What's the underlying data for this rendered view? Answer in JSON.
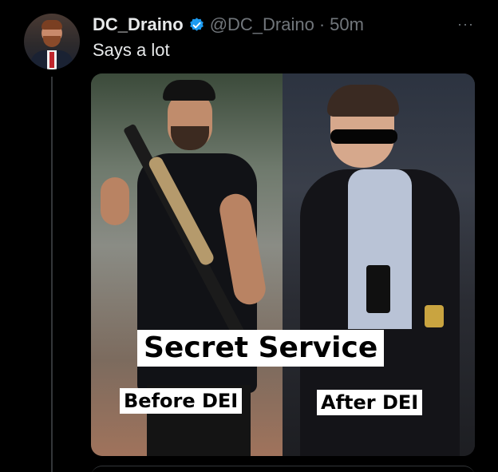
{
  "tweet": {
    "author_name": "DC_Draino",
    "handle": "@DC_Draino",
    "separator": "·",
    "time_ago": "50m",
    "text": "Says a lot",
    "more_glyph": "···",
    "verified_color": "#1d9bf0"
  },
  "media": {
    "headline": "Secret Service",
    "left_caption": "Before DEI",
    "right_caption": "After DEI"
  }
}
